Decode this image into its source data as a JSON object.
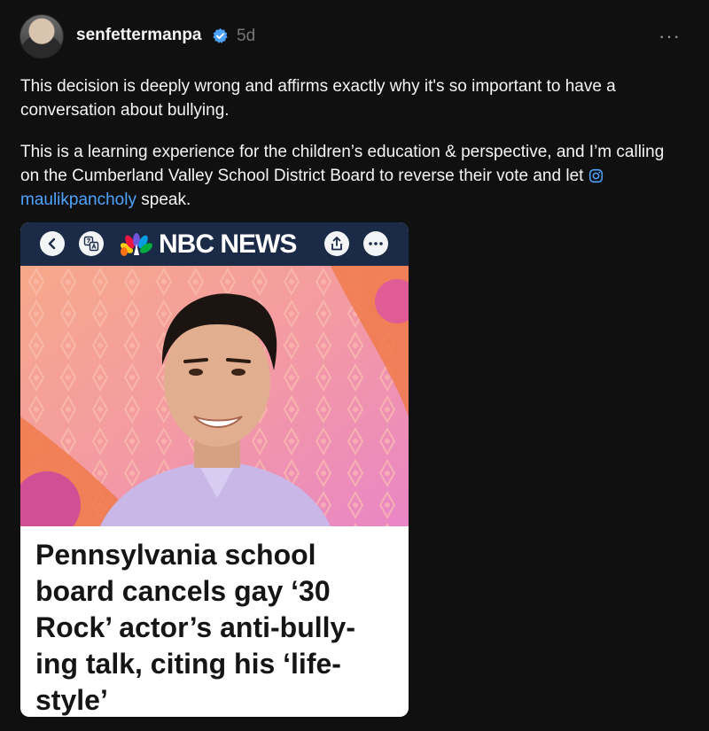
{
  "post": {
    "username": "senfettermanpa",
    "time": "5d",
    "more": "···",
    "paragraph1": "This decision is deeply wrong and affirms exactly why it's so important to have a conversation about bullying.",
    "paragraph2_before": "This is a learning experience for the children’s education & perspective, and I’m calling on the Cumberland Valley School District Board to reverse their vote and let",
    "mention": "maulikpancholy",
    "paragraph2_after": "speak."
  },
  "card": {
    "brand": "NBC NEWS",
    "headline": "Pennsylvania school board cancels gay ‘30 Rock’ actor’s anti-bully-ing talk, citing his ‘life-style’"
  },
  "icons": {
    "verified": "verified-badge-icon",
    "instagram": "instagram-icon",
    "back": "chevron-left-icon",
    "translate": "translate-icon",
    "share": "share-icon",
    "more": "more-dots-icon",
    "peacock": "nbc-peacock-icon"
  },
  "colors": {
    "background": "#101010",
    "mention": "#4da3ff",
    "verified": "#4da3ff",
    "nbc_nav": "#1b2a47"
  }
}
